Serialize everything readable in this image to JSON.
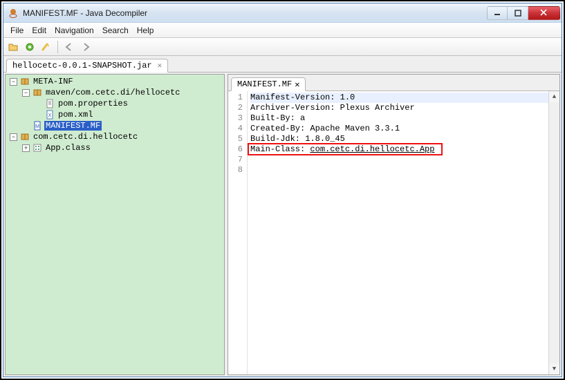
{
  "window": {
    "title": "MANIFEST.MF - Java Decompiler"
  },
  "menu": {
    "file": "File",
    "edit": "Edit",
    "navigation": "Navigation",
    "search": "Search",
    "help": "Help"
  },
  "tabs": {
    "jar": "hellocetc-0.0.1-SNAPSHOT.jar"
  },
  "tree": {
    "n0": "META-INF",
    "n1": "maven/com.cetc.di/hellocetc",
    "n2": "pom.properties",
    "n3": "pom.xml",
    "n4": "MANIFEST.MF",
    "n5": "com.cetc.di.hellocetc",
    "n6": "App.class"
  },
  "editor": {
    "tab": "MANIFEST.MF",
    "l1": "Manifest-Version: 1.0",
    "l2": "Archiver-Version: Plexus Archiver",
    "l3": "Built-By: a",
    "l4": "Created-By: Apache Maven 3.3.1",
    "l5": "Build-Jdk: 1.8.0_45",
    "l6a": "Main-Class: ",
    "l6b": "com.cetc.di.hellocetc.App",
    "ln1": "1",
    "ln2": "2",
    "ln3": "3",
    "ln4": "4",
    "ln5": "5",
    "ln6": "6",
    "ln7": "7",
    "ln8": "8"
  }
}
